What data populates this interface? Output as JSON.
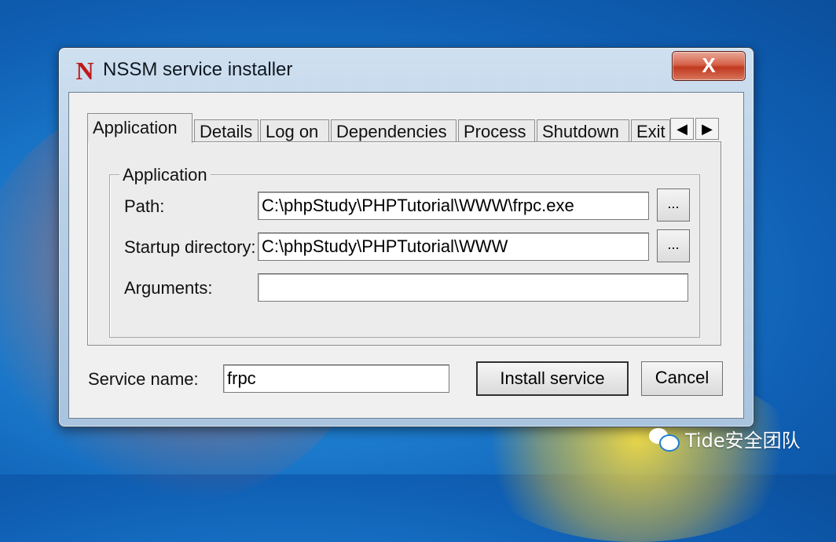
{
  "window": {
    "title": "NSSM service installer",
    "app_icon_glyph": "N",
    "close_glyph": "X"
  },
  "tabs": [
    {
      "label": "Application",
      "active": true
    },
    {
      "label": "Details",
      "active": false
    },
    {
      "label": "Log on",
      "active": false
    },
    {
      "label": "Dependencies",
      "active": false
    },
    {
      "label": "Process",
      "active": false
    },
    {
      "label": "Shutdown",
      "active": false
    },
    {
      "label": "Exit",
      "active": false
    }
  ],
  "tab_scroll": {
    "left": "◀",
    "right": "▶"
  },
  "application": {
    "group_title": "Application",
    "path_label": "Path:",
    "path_value": "C:\\phpStudy\\PHPTutorial\\WWW\\frpc.exe",
    "startup_label": "Startup directory:",
    "startup_value": "C:\\phpStudy\\PHPTutorial\\WWW",
    "arguments_label": "Arguments:",
    "arguments_value": "",
    "browse_label": "..."
  },
  "footer": {
    "service_name_label": "Service name:",
    "service_name_value": "frpc",
    "install_label": "Install service",
    "cancel_label": "Cancel"
  },
  "watermark": {
    "text": "Tide安全团队",
    "icon": "wechat-icon"
  },
  "colors": {
    "close_red": "#c0381e",
    "icon_red": "#c01818"
  }
}
